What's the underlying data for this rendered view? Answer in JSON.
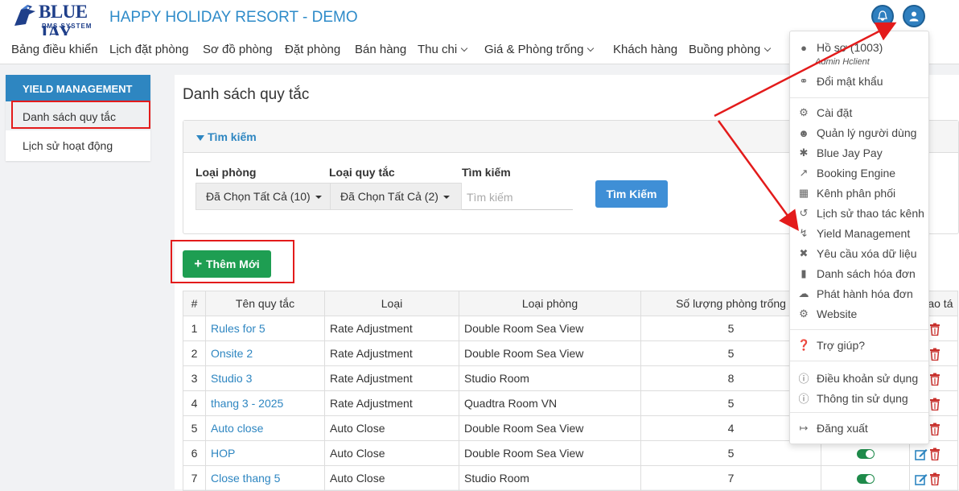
{
  "app": {
    "logo_text": "BLUE JAY",
    "logo_sub": "PMS SYSTEM",
    "title": "HAPPY HOLIDAY RESORT - DEMO"
  },
  "nav": [
    {
      "label": "Bảng điều khiển"
    },
    {
      "label": "Lịch đặt phòng"
    },
    {
      "label": "Sơ đồ phòng"
    },
    {
      "label": "Đặt phòng"
    },
    {
      "label": "Bán hàng"
    },
    {
      "label": "Thu chi"
    },
    {
      "label": "Giá & Phòng trống"
    },
    {
      "label": "Khách hàng"
    },
    {
      "label": "Buồng phòng"
    }
  ],
  "sidebar": {
    "heading": "YIELD MANAGEMENT",
    "items": [
      {
        "label": "Danh sách quy tắc"
      },
      {
        "label": "Lịch sử hoạt động"
      }
    ]
  },
  "main": {
    "title": "Danh sách quy tắc",
    "search": {
      "header": "Tìm kiếm",
      "room_type_label": "Loại phòng",
      "room_type_value": "Đã Chọn Tất Cả (10)",
      "rule_type_label": "Loại quy tắc",
      "rule_type_value": "Đã Chọn Tất Cả (2)",
      "keyword_label": "Tìm kiếm",
      "keyword_placeholder": "Tìm kiếm",
      "button": "Tìm Kiếm"
    },
    "add_button": "Thêm Mới",
    "table": {
      "headers": [
        "#",
        "Tên quy tắc",
        "Loại",
        "Loại phòng",
        "Số lượng phòng trống",
        "",
        "Thao tá"
      ],
      "rows": [
        {
          "n": "1",
          "name": "Rules for 5",
          "type": "Rate Adjustment",
          "room": "Double Room Sea View",
          "qty": "5",
          "toggle": false
        },
        {
          "n": "2",
          "name": "Onsite 2",
          "type": "Rate Adjustment",
          "room": "Double Room Sea View",
          "qty": "5",
          "toggle": false
        },
        {
          "n": "3",
          "name": "Studio 3",
          "type": "Rate Adjustment",
          "room": "Studio Room",
          "qty": "8",
          "toggle": false
        },
        {
          "n": "4",
          "name": "thang 3 - 2025",
          "type": "Rate Adjustment",
          "room": "Quadtra Room VN",
          "qty": "5",
          "toggle": false
        },
        {
          "n": "5",
          "name": "Auto close",
          "type": "Auto Close",
          "room": "Double Room Sea View",
          "qty": "4",
          "toggle": false
        },
        {
          "n": "6",
          "name": "HOP",
          "type": "Auto Close",
          "room": "Double Room Sea View",
          "qty": "5",
          "toggle": true
        },
        {
          "n": "7",
          "name": "Close thang 5",
          "type": "Auto Close",
          "room": "Studio Room",
          "qty": "7",
          "toggle": true
        }
      ]
    }
  },
  "user_menu": {
    "profile": "Hồ sơ  (1003)",
    "profile_sub": "Admin Hclient",
    "change_password": "Đổi mật khẩu",
    "settings": "Cài đặt",
    "user_management": "Quản lý người dùng",
    "pay": "Blue Jay Pay",
    "booking_engine": "Booking Engine",
    "channel": "Kênh phân phối",
    "channel_history": "Lịch sử thao tác kênh",
    "yield": "Yield Management",
    "delete_request": "Yêu cầu xóa dữ liệu",
    "invoice_list": "Danh sách hóa đơn",
    "issue_invoice": "Phát hành hóa đơn",
    "website": "Website",
    "help": "Trợ giúp?",
    "terms": "Điều khoản sử dụng",
    "usage_info": "Thông tin sử dụng",
    "logout": "Đăng xuất"
  },
  "colors": {
    "primary": "#2e86c1",
    "success": "#1e9e52",
    "danger": "#e31b1b"
  }
}
